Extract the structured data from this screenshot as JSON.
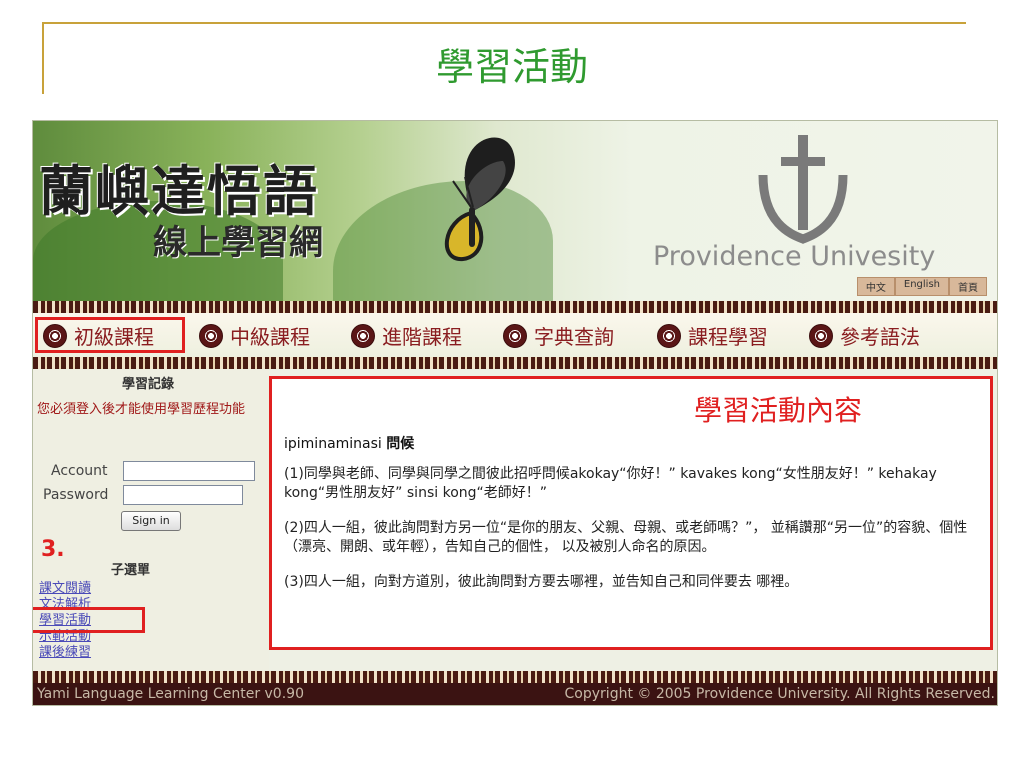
{
  "slide": {
    "title": "學習活動"
  },
  "banner": {
    "title_main": "蘭嶼達悟語",
    "title_sub": "線上學習網",
    "university": "Providence Univesity",
    "lang_links": [
      "中文",
      "English",
      "首頁"
    ]
  },
  "nav": {
    "items": [
      "初級課程",
      "中級課程",
      "進階課程",
      "字典查詢",
      "課程學習",
      "參考語法"
    ]
  },
  "sidebar": {
    "title": "學習記錄",
    "login_message": "您必須登入後才能使用學習歷程功能",
    "account_label": "Account",
    "password_label": "Password",
    "signin_label": "Sign in",
    "step_number": "3.",
    "submenu_title": "子選單",
    "submenu_links": [
      "課文閱讀",
      "文法解析",
      "學習活動",
      "示範活動",
      "課後練習"
    ]
  },
  "content": {
    "label": "學習活動內容",
    "heading_term": "ipiminaminasi",
    "heading_word": "問候",
    "paragraphs": [
      "(1)同學與老師、同學與同學之間彼此招呼問候akokay“你好！” kavakes kong“女性朋友好！” kehakay kong“男性朋友好” sinsi kong“老師好！”",
      "(2)四人一組，彼此詢問對方另一位“是你的朋友、父親、母親、或老師嗎？”， 並稱讚那“另一位”的容貌、個性（漂亮、開朗、或年輕），告知自己的個性， 以及被別人命名的原因。",
      "(3)四人一組，向對方道別，彼此詢問對方要去哪裡，並告知自己和同伴要去 哪裡。"
    ]
  },
  "footer": {
    "left": "Yami Language Learning Center v0.90",
    "right": "Copyright © 2005 Providence University. All Rights Reserved."
  },
  "colors": {
    "highlight": "#e02020",
    "nav_text": "#8a1d20",
    "title_green": "#2f9a2f",
    "footer_bg": "#3b1312"
  }
}
